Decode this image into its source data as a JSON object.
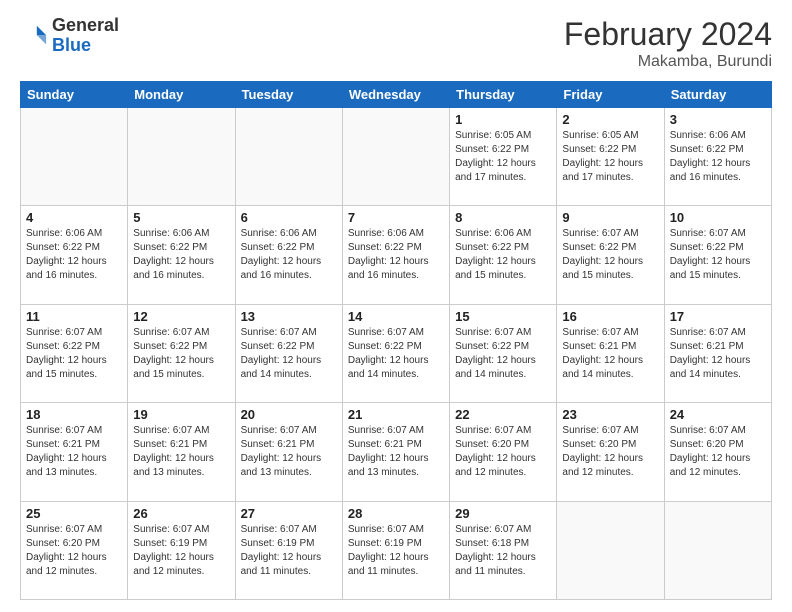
{
  "header": {
    "logo_general": "General",
    "logo_blue": "Blue",
    "month_title": "February 2024",
    "location": "Makamba, Burundi"
  },
  "days_of_week": [
    "Sunday",
    "Monday",
    "Tuesday",
    "Wednesday",
    "Thursday",
    "Friday",
    "Saturday"
  ],
  "weeks": [
    [
      {
        "num": "",
        "info": ""
      },
      {
        "num": "",
        "info": ""
      },
      {
        "num": "",
        "info": ""
      },
      {
        "num": "",
        "info": ""
      },
      {
        "num": "1",
        "info": "Sunrise: 6:05 AM\nSunset: 6:22 PM\nDaylight: 12 hours and 17 minutes."
      },
      {
        "num": "2",
        "info": "Sunrise: 6:05 AM\nSunset: 6:22 PM\nDaylight: 12 hours and 17 minutes."
      },
      {
        "num": "3",
        "info": "Sunrise: 6:06 AM\nSunset: 6:22 PM\nDaylight: 12 hours and 16 minutes."
      }
    ],
    [
      {
        "num": "4",
        "info": "Sunrise: 6:06 AM\nSunset: 6:22 PM\nDaylight: 12 hours and 16 minutes."
      },
      {
        "num": "5",
        "info": "Sunrise: 6:06 AM\nSunset: 6:22 PM\nDaylight: 12 hours and 16 minutes."
      },
      {
        "num": "6",
        "info": "Sunrise: 6:06 AM\nSunset: 6:22 PM\nDaylight: 12 hours and 16 minutes."
      },
      {
        "num": "7",
        "info": "Sunrise: 6:06 AM\nSunset: 6:22 PM\nDaylight: 12 hours and 16 minutes."
      },
      {
        "num": "8",
        "info": "Sunrise: 6:06 AM\nSunset: 6:22 PM\nDaylight: 12 hours and 15 minutes."
      },
      {
        "num": "9",
        "info": "Sunrise: 6:07 AM\nSunset: 6:22 PM\nDaylight: 12 hours and 15 minutes."
      },
      {
        "num": "10",
        "info": "Sunrise: 6:07 AM\nSunset: 6:22 PM\nDaylight: 12 hours and 15 minutes."
      }
    ],
    [
      {
        "num": "11",
        "info": "Sunrise: 6:07 AM\nSunset: 6:22 PM\nDaylight: 12 hours and 15 minutes."
      },
      {
        "num": "12",
        "info": "Sunrise: 6:07 AM\nSunset: 6:22 PM\nDaylight: 12 hours and 15 minutes."
      },
      {
        "num": "13",
        "info": "Sunrise: 6:07 AM\nSunset: 6:22 PM\nDaylight: 12 hours and 14 minutes."
      },
      {
        "num": "14",
        "info": "Sunrise: 6:07 AM\nSunset: 6:22 PM\nDaylight: 12 hours and 14 minutes."
      },
      {
        "num": "15",
        "info": "Sunrise: 6:07 AM\nSunset: 6:22 PM\nDaylight: 12 hours and 14 minutes."
      },
      {
        "num": "16",
        "info": "Sunrise: 6:07 AM\nSunset: 6:21 PM\nDaylight: 12 hours and 14 minutes."
      },
      {
        "num": "17",
        "info": "Sunrise: 6:07 AM\nSunset: 6:21 PM\nDaylight: 12 hours and 14 minutes."
      }
    ],
    [
      {
        "num": "18",
        "info": "Sunrise: 6:07 AM\nSunset: 6:21 PM\nDaylight: 12 hours and 13 minutes."
      },
      {
        "num": "19",
        "info": "Sunrise: 6:07 AM\nSunset: 6:21 PM\nDaylight: 12 hours and 13 minutes."
      },
      {
        "num": "20",
        "info": "Sunrise: 6:07 AM\nSunset: 6:21 PM\nDaylight: 12 hours and 13 minutes."
      },
      {
        "num": "21",
        "info": "Sunrise: 6:07 AM\nSunset: 6:21 PM\nDaylight: 12 hours and 13 minutes."
      },
      {
        "num": "22",
        "info": "Sunrise: 6:07 AM\nSunset: 6:20 PM\nDaylight: 12 hours and 12 minutes."
      },
      {
        "num": "23",
        "info": "Sunrise: 6:07 AM\nSunset: 6:20 PM\nDaylight: 12 hours and 12 minutes."
      },
      {
        "num": "24",
        "info": "Sunrise: 6:07 AM\nSunset: 6:20 PM\nDaylight: 12 hours and 12 minutes."
      }
    ],
    [
      {
        "num": "25",
        "info": "Sunrise: 6:07 AM\nSunset: 6:20 PM\nDaylight: 12 hours and 12 minutes."
      },
      {
        "num": "26",
        "info": "Sunrise: 6:07 AM\nSunset: 6:19 PM\nDaylight: 12 hours and 12 minutes."
      },
      {
        "num": "27",
        "info": "Sunrise: 6:07 AM\nSunset: 6:19 PM\nDaylight: 12 hours and 11 minutes."
      },
      {
        "num": "28",
        "info": "Sunrise: 6:07 AM\nSunset: 6:19 PM\nDaylight: 12 hours and 11 minutes."
      },
      {
        "num": "29",
        "info": "Sunrise: 6:07 AM\nSunset: 6:18 PM\nDaylight: 12 hours and 11 minutes."
      },
      {
        "num": "",
        "info": ""
      },
      {
        "num": "",
        "info": ""
      }
    ]
  ]
}
